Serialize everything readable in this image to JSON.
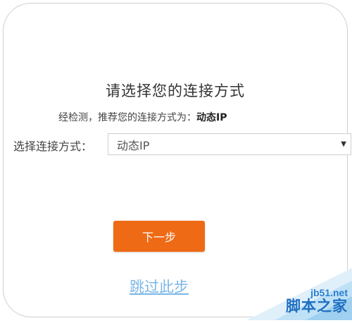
{
  "page": {
    "title": "请选择您的连接方式",
    "detect_prefix": "经检测，推荐您的连接方式为：",
    "detect_value": "动态IP",
    "select_label": "选择连接方式：",
    "select_value": "动态IP",
    "next_button": "下一步",
    "skip_link": "跳过此步"
  },
  "watermark": {
    "url": "jb51.net",
    "name": "脚本之家"
  },
  "colors": {
    "accent": "#ef6a15",
    "link": "#7ab6e6"
  }
}
